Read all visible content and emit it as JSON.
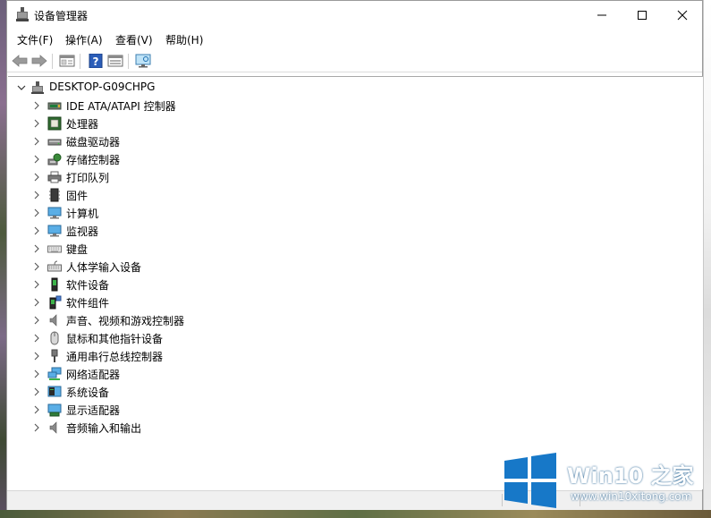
{
  "window": {
    "title": "设备管理器"
  },
  "menu": [
    {
      "label": "文件(F)"
    },
    {
      "label": "操作(A)"
    },
    {
      "label": "查看(V)"
    },
    {
      "label": "帮助(H)"
    }
  ],
  "toolbar": {
    "buttons": [
      "back-arrow-icon",
      "forward-arrow-icon",
      "properties-icon",
      "help-icon",
      "update-driver-icon",
      "monitor-scan-icon"
    ]
  },
  "tree": {
    "root": "DESKTOP-G09CHPG",
    "items": [
      {
        "label": "IDE ATA/ATAPI 控制器",
        "icon": "ide-controller-icon"
      },
      {
        "label": "处理器",
        "icon": "processor-icon"
      },
      {
        "label": "磁盘驱动器",
        "icon": "disk-drive-icon"
      },
      {
        "label": "存储控制器",
        "icon": "storage-controller-icon"
      },
      {
        "label": "打印队列",
        "icon": "printer-icon"
      },
      {
        "label": "固件",
        "icon": "firmware-icon"
      },
      {
        "label": "计算机",
        "icon": "computer-icon"
      },
      {
        "label": "监视器",
        "icon": "monitor-icon"
      },
      {
        "label": "键盘",
        "icon": "keyboard-icon"
      },
      {
        "label": "人体学输入设备",
        "icon": "hid-icon"
      },
      {
        "label": "软件设备",
        "icon": "software-device-icon"
      },
      {
        "label": "软件组件",
        "icon": "software-component-icon"
      },
      {
        "label": "声音、视频和游戏控制器",
        "icon": "sound-icon"
      },
      {
        "label": "鼠标和其他指针设备",
        "icon": "mouse-icon"
      },
      {
        "label": "通用串行总线控制器",
        "icon": "usb-icon"
      },
      {
        "label": "网络适配器",
        "icon": "network-adapter-icon"
      },
      {
        "label": "系统设备",
        "icon": "system-device-icon"
      },
      {
        "label": "显示适配器",
        "icon": "display-adapter-icon"
      },
      {
        "label": "音频输入和输出",
        "icon": "audio-io-icon"
      }
    ]
  },
  "watermark": {
    "brand": "Win10 之家",
    "url": "www.win10xitong.com"
  },
  "colors": {
    "accent": "#1e8fd6",
    "watermark_blue": "#1778c8"
  }
}
